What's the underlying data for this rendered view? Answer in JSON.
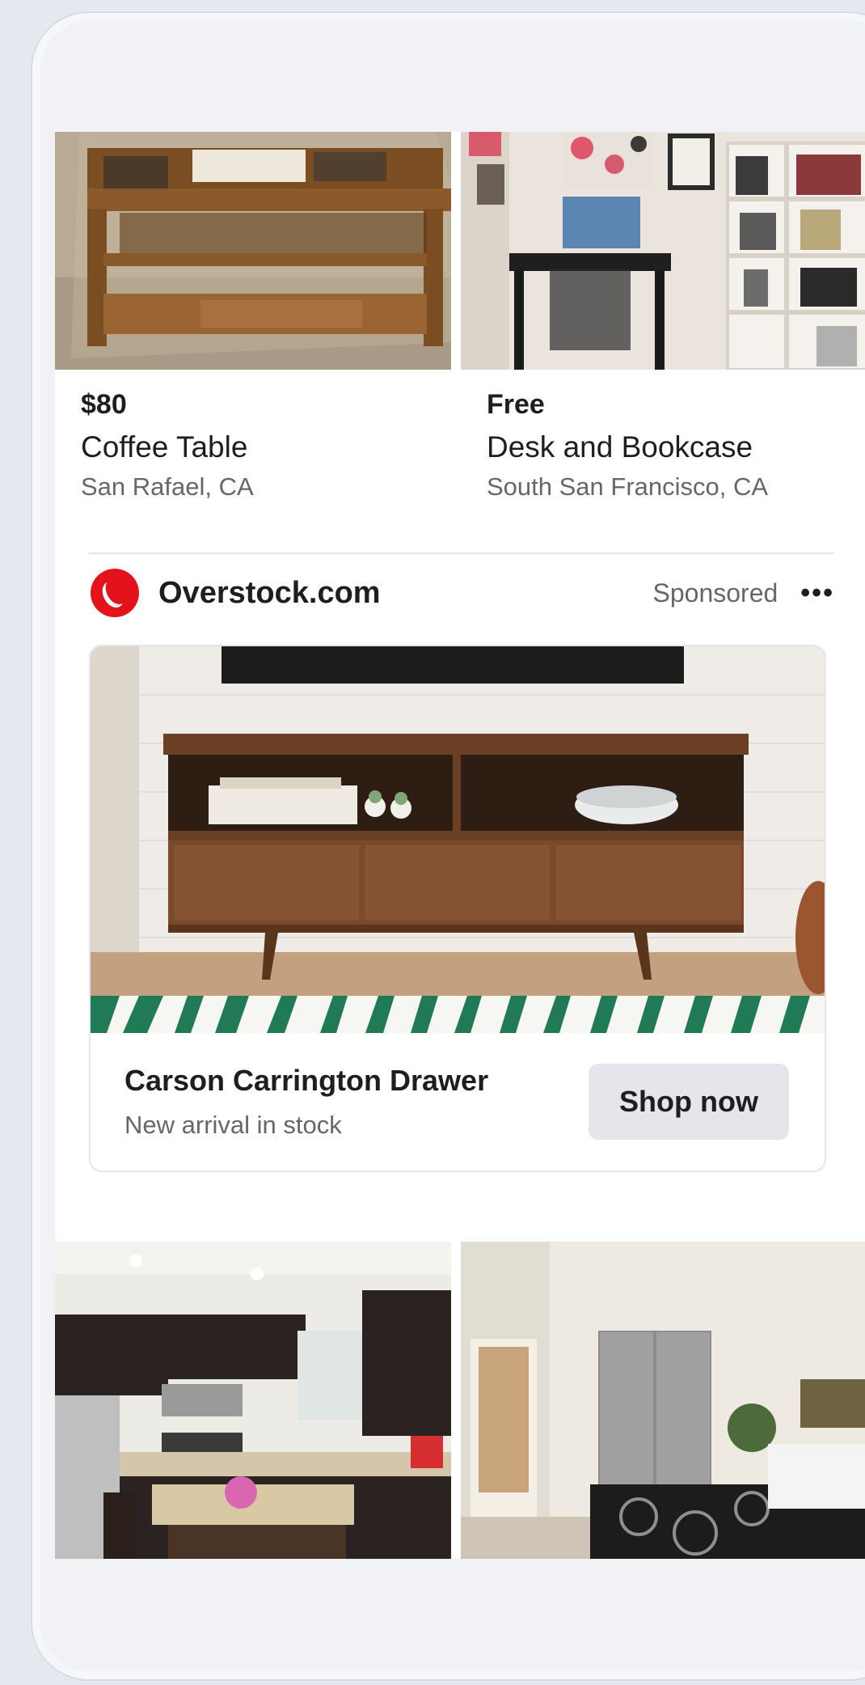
{
  "listings": [
    {
      "price": "$80",
      "title": "Coffee Table",
      "location": "San Rafael, CA"
    },
    {
      "price": "Free",
      "title": "Desk and Bookcase",
      "location": "South San Francisco, CA"
    }
  ],
  "ad": {
    "brand": "Overstock.com",
    "sponsored": "Sponsored",
    "more": "•••",
    "product_title": "Carson Carrington Drawer",
    "product_subtitle": "New arrival in stock",
    "cta": "Shop now",
    "brand_color": "#e3131b"
  },
  "icons": {
    "brand_logo": "overstock-logo-icon",
    "more": "more-options-icon"
  }
}
